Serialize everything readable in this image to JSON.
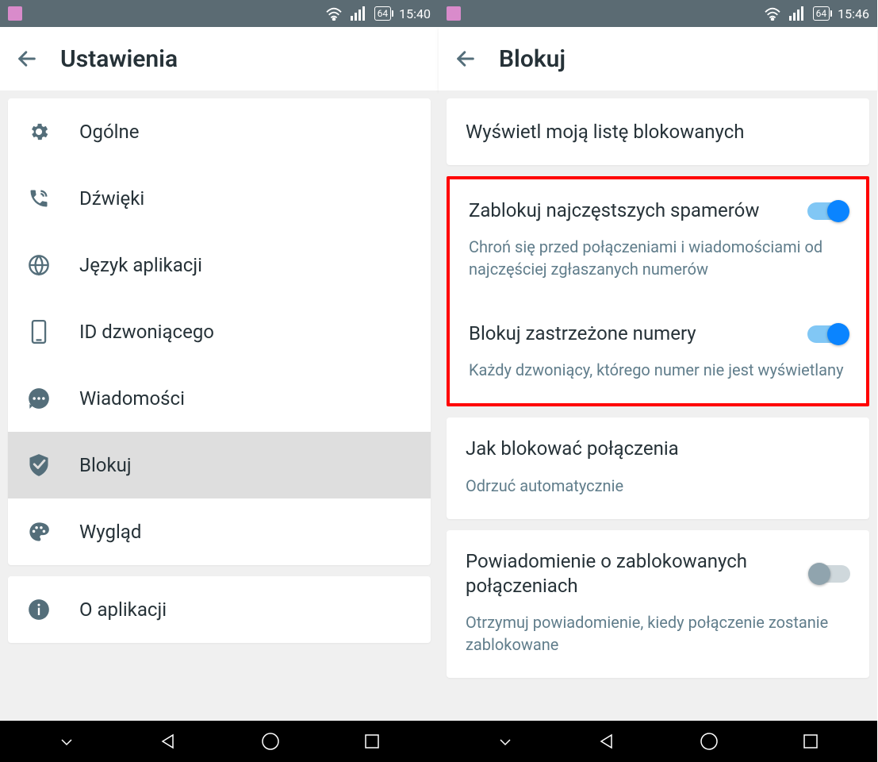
{
  "left": {
    "status": {
      "battery": "64",
      "time": "15:40"
    },
    "header": {
      "title": "Ustawienia"
    },
    "menu": [
      {
        "icon": "gear-icon",
        "label": "Ogólne"
      },
      {
        "icon": "phone-sound-icon",
        "label": "Dźwięki"
      },
      {
        "icon": "globe-icon",
        "label": "Język aplikacji"
      },
      {
        "icon": "phone-id-icon",
        "label": "ID dzwoniącego"
      },
      {
        "icon": "message-icon",
        "label": "Wiadomości"
      },
      {
        "icon": "shield-icon",
        "label": "Blokuj",
        "selected": true
      },
      {
        "icon": "palette-icon",
        "label": "Wygląd"
      }
    ],
    "about": {
      "icon": "info-icon",
      "label": "O aplikacji"
    }
  },
  "right": {
    "status": {
      "battery": "64",
      "time": "15:46"
    },
    "header": {
      "title": "Blokuj"
    },
    "view_list": "Wyświetl moją listę blokowanych",
    "spam": {
      "title": "Zablokuj najczęstszych spamerów",
      "sub": "Chroń się przed połączeniami i wiadomościami od najczęściej zgłaszanych numerów",
      "on": true
    },
    "private": {
      "title": "Blokuj zastrzeżone numery",
      "sub": "Każdy dzwoniący, którego numer nie jest wyświetlany",
      "on": true
    },
    "howblock": {
      "title": "Jak blokować połączenia",
      "sub": "Odrzuć automatycznie"
    },
    "notify": {
      "title": "Powiadomienie o zablokowanych połączeniach",
      "sub": "Otrzymuj powiadomienie, kiedy połączenie zostanie zablokowane",
      "on": false
    }
  }
}
